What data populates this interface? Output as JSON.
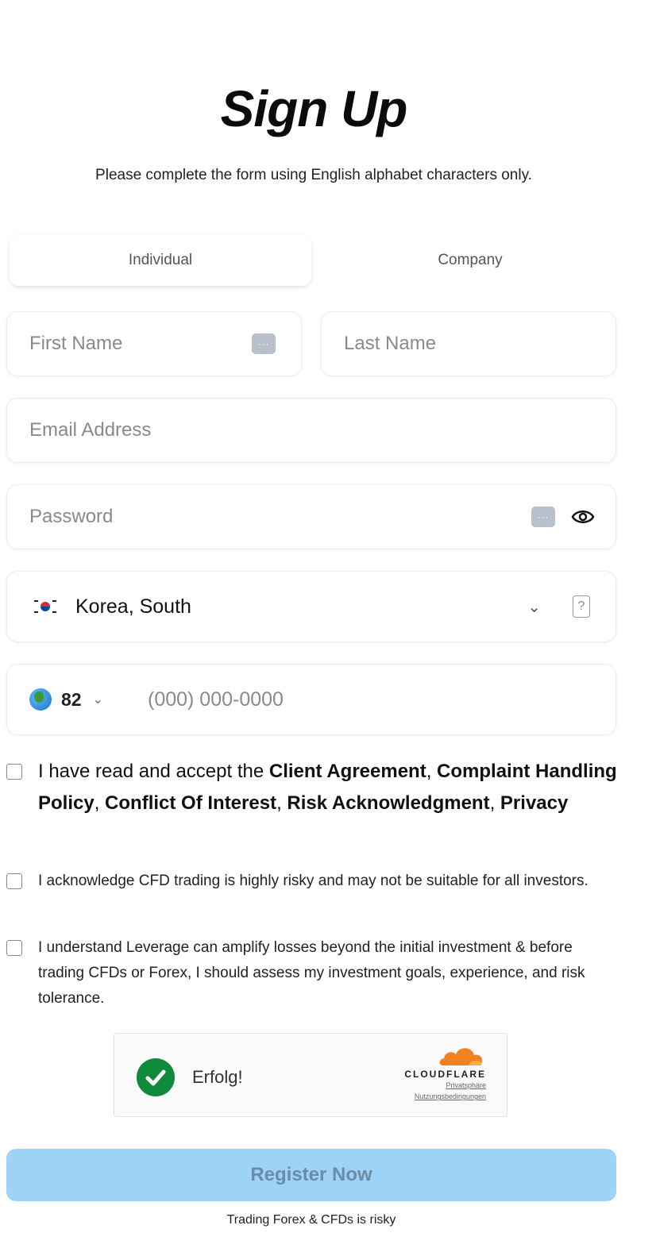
{
  "header": {
    "title": "Sign Up",
    "subtitle": "Please complete the form using English alphabet characters only."
  },
  "tabs": [
    {
      "label": "Individual",
      "selected": true
    },
    {
      "label": "Company",
      "selected": false
    }
  ],
  "form": {
    "first_name_placeholder": "First Name",
    "last_name_placeholder": "Last Name",
    "email_placeholder": "Email Address",
    "password_placeholder": "Password",
    "country_value": "Korea, South",
    "dial_code": "82",
    "phone_placeholder": "(000) 000-0000",
    "keypass_glyph": "···",
    "help_glyph": "?",
    "chevron_glyph": "⌄"
  },
  "consents": {
    "c1_prefix": "I have read and accept the ",
    "c1_links": [
      "Client Agreement",
      "Complaint Handling Policy",
      "Conflict Of Interest",
      "Risk Acknowledgment",
      "Privacy"
    ],
    "c2_text": "I acknowledge CFD trading is highly risky and may not be suitable for all investors.",
    "c3_text": "I understand Leverage can amplify losses beyond the initial investment & before trading CFDs or Forex, I should assess my investment goals, experience, and risk tolerance."
  },
  "captcha": {
    "status": "Erfolg!",
    "brand": "CLOUDFLARE",
    "privacy_link": "Privatsphäre",
    "terms_link": "Nutzungsbedingungen"
  },
  "register_label": "Register Now",
  "footer_note": "Trading Forex & CFDs is risky",
  "colors": {
    "button_bg": "#9ed3f7",
    "button_text": "#6a8ca5",
    "success_green": "#118a3c",
    "cloudflare_orange": "#f48120"
  },
  "icons": {
    "keypass": "password-manager-icon",
    "eye": "eye-icon",
    "flag": "korea-flag-icon",
    "globe": "globe-icon",
    "help": "help-icon",
    "check": "check-circle-icon",
    "cloud": "cloudflare-cloud-icon"
  }
}
